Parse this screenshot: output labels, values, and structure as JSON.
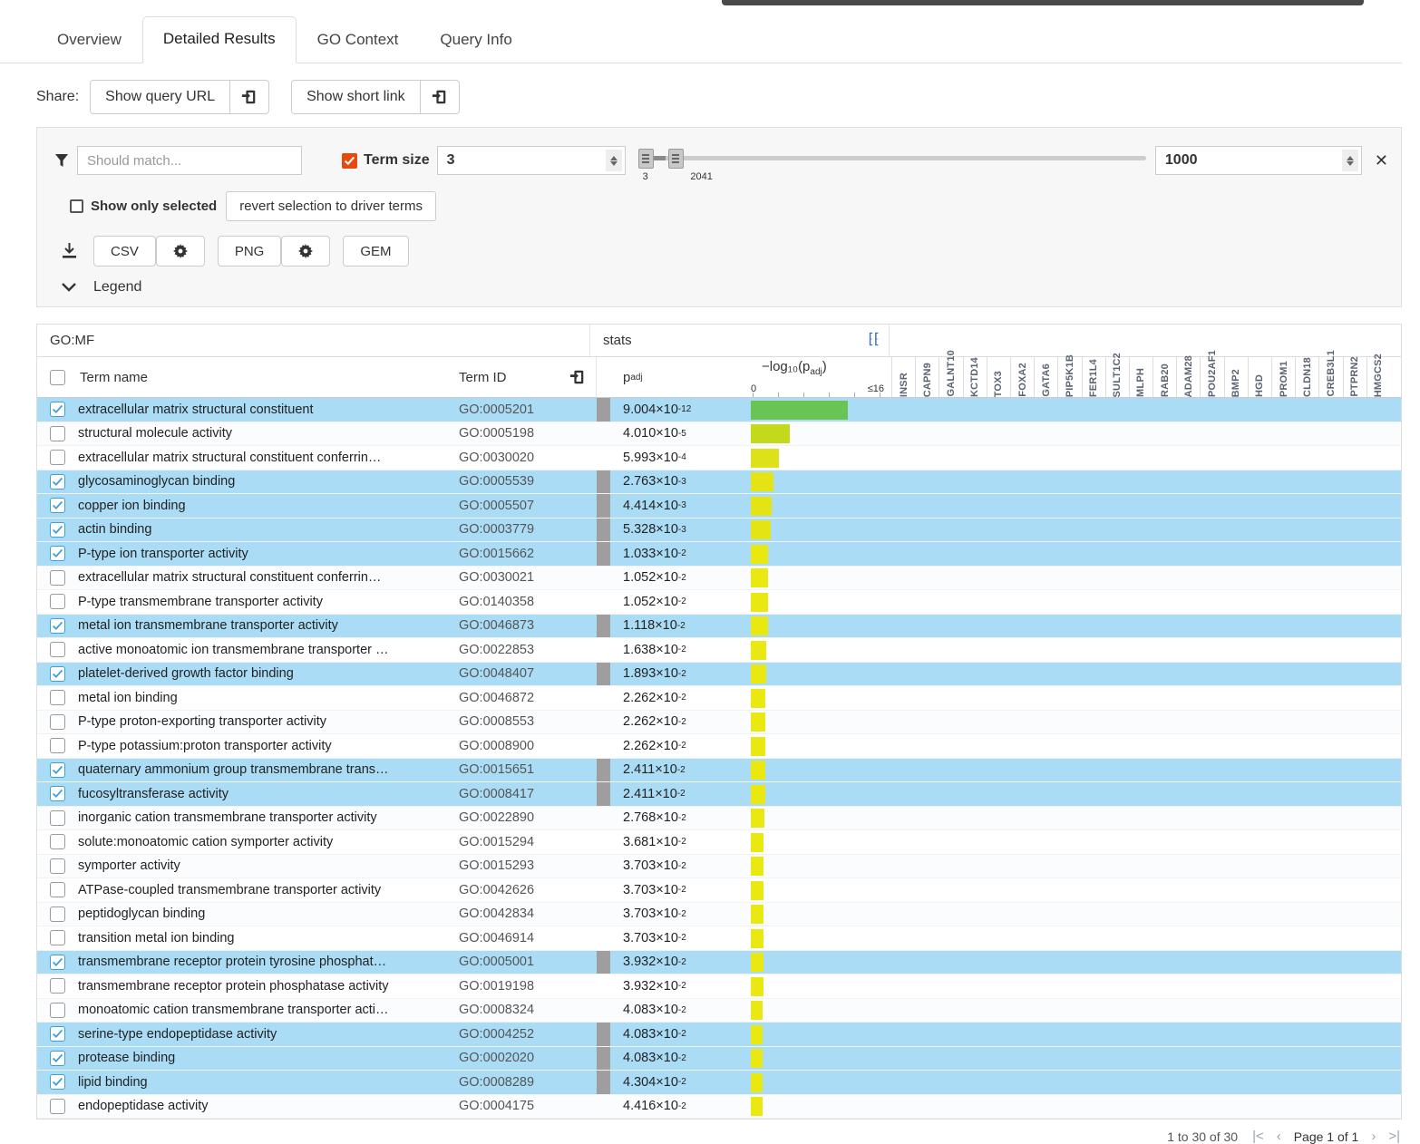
{
  "tabs": [
    {
      "label": "Overview",
      "active": false
    },
    {
      "label": "Detailed Results",
      "active": true
    },
    {
      "label": "GO Context",
      "active": false
    },
    {
      "label": "Query Info",
      "active": false
    }
  ],
  "share": {
    "label": "Share:",
    "query_url_label": "Show query URL",
    "short_link_label": "Show short link",
    "copy_icon": "clipboard-icon"
  },
  "filter": {
    "funnel_icon": "funnel-icon",
    "match_placeholder": "Should match...",
    "match_value": "",
    "term_size_label": "Term size",
    "term_size_checked": true,
    "min_value": "3",
    "max_value": "1000",
    "slider_min_tick": "3",
    "slider_max_tick": "2041",
    "clear_icon": "x-close-icon",
    "show_only_selected_label": "Show only selected",
    "show_only_selected_checked": false,
    "revert_button_label": "revert selection to driver terms"
  },
  "download": {
    "icon": "download-icon",
    "buttons": [
      "CSV",
      "PNG",
      "GEM"
    ],
    "gear_icon": "gear-icon"
  },
  "legend": {
    "label": "Legend",
    "icon": "chevron-down-icon"
  },
  "table": {
    "group_headers": {
      "term": "GO:MF",
      "stats": "stats",
      "expand_icon": "expand-chevrons-icon"
    },
    "columns": {
      "select_all": "select-all-checkbox",
      "term_name": "Term name",
      "term_id": "Term ID",
      "copy_icon": "clipboard-icon",
      "p_adj": "p",
      "p_adj_sub": "adj",
      "bar_axis_title": "−log₁₀(p",
      "bar_axis_title_sub": "adj",
      "bar_axis_title_end": ")",
      "axis_min": "0",
      "axis_max": "≤16"
    },
    "genes": [
      "INSR",
      "CAPN9",
      "GALNT10",
      "KCTD14",
      "TOX3",
      "FOXA2",
      "GATA6",
      "PIP5K1B",
      "FER1L4",
      "SULT1C2",
      "MLPH",
      "RAB20",
      "ADAM28",
      "POU2AF1",
      "BMP2",
      "HGD",
      "PROM1",
      "CLDN18",
      "CREB3L1",
      "PTPRN2",
      "HMGCS2"
    ],
    "rows": [
      {
        "selected": true,
        "driver": true,
        "name": "extracellular matrix structural constituent",
        "id": "GO:0005201",
        "p_mantissa": "9.004×10",
        "p_exp": "-12",
        "neglog": 11.05,
        "color": "#68c453",
        "genes": {}
      },
      {
        "selected": false,
        "driver": false,
        "name": "structural molecule activity",
        "id": "GO:0005198",
        "p_mantissa": "4.010×10",
        "p_exp": "-5",
        "neglog": 4.4,
        "color": "#c3d91c",
        "genes": {}
      },
      {
        "selected": false,
        "driver": false,
        "name": "extracellular matrix structural constituent conferrin…",
        "id": "GO:0030020",
        "p_mantissa": "5.993×10",
        "p_exp": "-4",
        "neglog": 3.22,
        "color": "#dde218",
        "genes": {}
      },
      {
        "selected": true,
        "driver": true,
        "name": "glycosaminoglycan binding",
        "id": "GO:0005539",
        "p_mantissa": "2.763×10",
        "p_exp": "-3",
        "neglog": 2.56,
        "color": "#e4e415",
        "genes": {}
      },
      {
        "selected": true,
        "driver": true,
        "name": "copper ion binding",
        "id": "GO:0005507",
        "p_mantissa": "4.414×10",
        "p_exp": "-3",
        "neglog": 2.36,
        "color": "#e4e415",
        "genes": {}
      },
      {
        "selected": true,
        "driver": true,
        "name": "actin binding",
        "id": "GO:0003779",
        "p_mantissa": "5.328×10",
        "p_exp": "-3",
        "neglog": 2.27,
        "color": "#e4e415",
        "genes": {
          "MLPH": "#ffa400"
        }
      },
      {
        "selected": true,
        "driver": true,
        "name": "P-type ion transporter activity",
        "id": "GO:0015662",
        "p_mantissa": "1.033×10",
        "p_exp": "-2",
        "neglog": 1.99,
        "color": "#e9e811",
        "genes": {}
      },
      {
        "selected": false,
        "driver": false,
        "name": "extracellular matrix structural constituent conferrin…",
        "id": "GO:0030021",
        "p_mantissa": "1.052×10",
        "p_exp": "-2",
        "neglog": 1.98,
        "color": "#e9e811",
        "genes": {}
      },
      {
        "selected": false,
        "driver": false,
        "name": "P-type transmembrane transporter activity",
        "id": "GO:0140358",
        "p_mantissa": "1.052×10",
        "p_exp": "-2",
        "neglog": 1.98,
        "color": "#e9e811",
        "genes": {}
      },
      {
        "selected": true,
        "driver": true,
        "name": "metal ion transmembrane transporter activity",
        "id": "GO:0046873",
        "p_mantissa": "1.118×10",
        "p_exp": "-2",
        "neglog": 1.95,
        "color": "#e9e811",
        "genes": {}
      },
      {
        "selected": false,
        "driver": false,
        "name": "active monoatomic ion transmembrane transporter …",
        "id": "GO:0022853",
        "p_mantissa": "1.638×10",
        "p_exp": "-2",
        "neglog": 1.79,
        "color": "#e9e811",
        "genes": {}
      },
      {
        "selected": true,
        "driver": true,
        "name": "platelet-derived growth factor binding",
        "id": "GO:0048407",
        "p_mantissa": "1.893×10",
        "p_exp": "-2",
        "neglog": 1.72,
        "color": "#e9e811",
        "genes": {}
      },
      {
        "selected": false,
        "driver": false,
        "name": "metal ion binding",
        "id": "GO:0046872",
        "p_mantissa": "2.262×10",
        "p_exp": "-2",
        "neglog": 1.65,
        "color": "#e9e811",
        "genes": {
          "CAPN9": "#90ee90"
        }
      },
      {
        "selected": false,
        "driver": false,
        "name": "P-type proton-exporting transporter activity",
        "id": "GO:0008553",
        "p_mantissa": "2.262×10",
        "p_exp": "-2",
        "neglog": 1.65,
        "color": "#e9e811",
        "genes": {}
      },
      {
        "selected": false,
        "driver": false,
        "name": "P-type potassium:proton transporter activity",
        "id": "GO:0008900",
        "p_mantissa": "2.262×10",
        "p_exp": "-2",
        "neglog": 1.65,
        "color": "#e9e811",
        "genes": {}
      },
      {
        "selected": true,
        "driver": true,
        "name": "quaternary ammonium group transmembrane trans…",
        "id": "GO:0015651",
        "p_mantissa": "2.411×10",
        "p_exp": "-2",
        "neglog": 1.62,
        "color": "#e9e811",
        "genes": {}
      },
      {
        "selected": true,
        "driver": true,
        "name": "fucosyltransferase activity",
        "id": "GO:0008417",
        "p_mantissa": "2.411×10",
        "p_exp": "-2",
        "neglog": 1.62,
        "color": "#e9e811",
        "genes": {}
      },
      {
        "selected": false,
        "driver": false,
        "name": "inorganic cation transmembrane transporter activity",
        "id": "GO:0022890",
        "p_mantissa": "2.768×10",
        "p_exp": "-2",
        "neglog": 1.56,
        "color": "#e9e811",
        "genes": {}
      },
      {
        "selected": false,
        "driver": false,
        "name": "solute:monoatomic cation symporter activity",
        "id": "GO:0015294",
        "p_mantissa": "3.681×10",
        "p_exp": "-2",
        "neglog": 1.43,
        "color": "#e9e811",
        "genes": {}
      },
      {
        "selected": false,
        "driver": false,
        "name": "symporter activity",
        "id": "GO:0015293",
        "p_mantissa": "3.703×10",
        "p_exp": "-2",
        "neglog": 1.43,
        "color": "#e9e811",
        "genes": {}
      },
      {
        "selected": false,
        "driver": false,
        "name": "ATPase-coupled transmembrane transporter activity",
        "id": "GO:0042626",
        "p_mantissa": "3.703×10",
        "p_exp": "-2",
        "neglog": 1.43,
        "color": "#e9e811",
        "genes": {}
      },
      {
        "selected": false,
        "driver": false,
        "name": "peptidoglycan binding",
        "id": "GO:0042834",
        "p_mantissa": "3.703×10",
        "p_exp": "-2",
        "neglog": 1.43,
        "color": "#e9e811",
        "genes": {}
      },
      {
        "selected": false,
        "driver": false,
        "name": "transition metal ion binding",
        "id": "GO:0046914",
        "p_mantissa": "3.703×10",
        "p_exp": "-2",
        "neglog": 1.43,
        "color": "#e9e811",
        "genes": {}
      },
      {
        "selected": true,
        "driver": true,
        "name": "transmembrane receptor protein tyrosine phosphat…",
        "id": "GO:0005001",
        "p_mantissa": "3.932×10",
        "p_exp": "-2",
        "neglog": 1.41,
        "color": "#e9e811",
        "genes": {
          "PTPRN2": "#90ee90"
        }
      },
      {
        "selected": false,
        "driver": false,
        "name": "transmembrane receptor protein phosphatase activity",
        "id": "GO:0019198",
        "p_mantissa": "3.932×10",
        "p_exp": "-2",
        "neglog": 1.41,
        "color": "#e9e811",
        "genes": {
          "PTPRN2": "#90ee90"
        }
      },
      {
        "selected": false,
        "driver": false,
        "name": "monoatomic cation transmembrane transporter acti…",
        "id": "GO:0008324",
        "p_mantissa": "4.083×10",
        "p_exp": "-2",
        "neglog": 1.39,
        "color": "#e9e811",
        "genes": {}
      },
      {
        "selected": true,
        "driver": true,
        "name": "serine-type endopeptidase activity",
        "id": "GO:0004252",
        "p_mantissa": "4.083×10",
        "p_exp": "-2",
        "neglog": 1.39,
        "color": "#e9e811",
        "genes": {}
      },
      {
        "selected": true,
        "driver": true,
        "name": "protease binding",
        "id": "GO:0002020",
        "p_mantissa": "4.083×10",
        "p_exp": "-2",
        "neglog": 1.39,
        "color": "#e9e811",
        "genes": {}
      },
      {
        "selected": true,
        "driver": true,
        "name": "lipid binding",
        "id": "GO:0008289",
        "p_mantissa": "4.304×10",
        "p_exp": "-2",
        "neglog": 1.37,
        "color": "#e9e811",
        "genes": {
          "PROM1": "#ffa400"
        }
      },
      {
        "selected": false,
        "driver": false,
        "name": "endopeptidase activity",
        "id": "GO:0004175",
        "p_mantissa": "4.416×10",
        "p_exp": "-2",
        "neglog": 1.35,
        "color": "#e9e811",
        "genes": {
          "CAPN9": "#90ee90",
          "ADAM28": "#ffa400"
        }
      }
    ]
  },
  "footer": {
    "count_text": "1 to 30 of 30",
    "first_icon": "|<",
    "prev_icon": "‹",
    "page_text": "Page 1 of 1",
    "next_icon": "›",
    "last_icon": ">|"
  },
  "colors": {
    "selected_row": "#aadcf5",
    "high_significance": "#68c453",
    "low_significance": "#e9e811",
    "orange_cell": "#ffa400",
    "green_cell": "#90ee90",
    "accent_orange": "#e8480c"
  }
}
